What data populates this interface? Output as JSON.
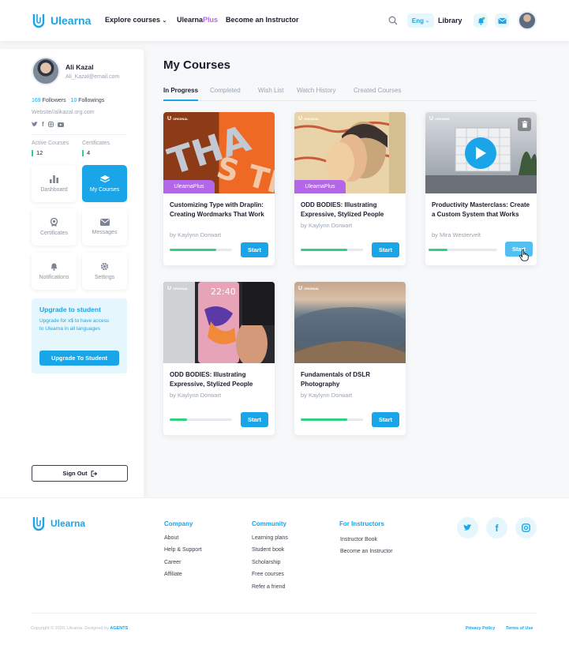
{
  "header": {
    "brand": "Ulearna",
    "nav": {
      "explore": "Explore courses",
      "ulearna": "Ulearna",
      "plus": "Plus",
      "become": "Become an Instructor"
    },
    "lang": "Eng",
    "library": "Library"
  },
  "profile": {
    "name": "Ali Kazal",
    "email": "Ali_Kazal@email.com",
    "followers_count": "169",
    "followers_label": "Followers",
    "followings_count": "10",
    "followings_label": "Followings",
    "website": "Website//alikazal.org.com",
    "active_courses_label": "Active Courses",
    "active_courses": "12",
    "certificates_label": "Certificates",
    "certificates": "4"
  },
  "menu": [
    {
      "label": "Dashboard",
      "icon": "bar-chart-icon"
    },
    {
      "label": "My Courses",
      "icon": "layers-icon"
    },
    {
      "label": "Certificates",
      "icon": "award-icon"
    },
    {
      "label": "Messages",
      "icon": "envelope-icon"
    },
    {
      "label": "Notifications",
      "icon": "bell-icon"
    },
    {
      "label": "Settings",
      "icon": "gear-icon"
    }
  ],
  "upgrade": {
    "title": "Upgrade to student",
    "text": "Upgrade for x$ to have access to Ulearna in all languages",
    "button": "Upgrade To Student"
  },
  "signout": "Sign Out",
  "page_title": "My Courses",
  "tabs": [
    "In Progress",
    "Completed",
    "Wish List",
    "Watch History",
    "Created Courses"
  ],
  "original_label": "ORIGINAL",
  "plus_badge": "UlearnaPlus",
  "courses": [
    {
      "title": "Customizing Type with Draplin: Creating Wordmarks That Work",
      "author": "by Kaylynn Dorwart",
      "progress": 0.75,
      "button": "Start"
    },
    {
      "title": "ODD BODIES: Illustrating Expressive, Stylized People",
      "author": "by Kaylynn Dorwart",
      "progress": 0.75,
      "button": "Start"
    },
    {
      "title": "Productivity Masterclass: Create a Custom System that Works",
      "author": "by Mira Westervelt",
      "progress": 0.28,
      "button": "Start"
    },
    {
      "title": "ODD BODIES: Illustrating Expressive, Stylized People",
      "author": "by Kaylynn Dorwart",
      "progress": 0.28,
      "button": "Start"
    },
    {
      "title": "Fundamentals of DSLR Photography",
      "author": "by Kaylynn Dorwart",
      "progress": 0.75,
      "button": "Start"
    }
  ],
  "footer": {
    "brand": "Ulearna",
    "company": {
      "title": "Company",
      "links": [
        "About",
        "Help & Support",
        "Career",
        "Affiliate"
      ]
    },
    "community": {
      "title": "Community",
      "links": [
        "Learning plans",
        "Student book",
        "Scholarship",
        "Free courses",
        "Refer a friend"
      ]
    },
    "instructors": {
      "title": "For Instructors",
      "links": [
        "Instructor Book",
        "Become an Instructor"
      ]
    },
    "copyright": "Copyright © 2020. Ulearna. Designed by",
    "designer": "AGENTS",
    "privacy": "Privacy Policy",
    "terms": "Terms of Use"
  },
  "colors": {
    "accent": "#1aa5e8",
    "purple": "#b266e8",
    "green": "#2ed27f"
  }
}
